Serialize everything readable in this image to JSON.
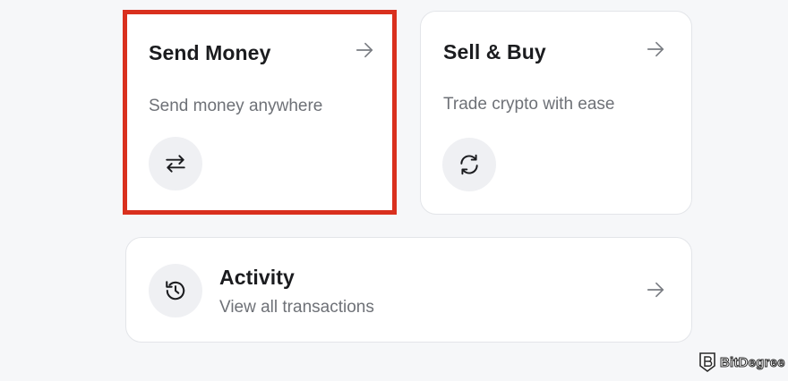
{
  "cards": {
    "send": {
      "title": "Send Money",
      "subtitle": "Send money anywhere",
      "icon": "swap-arrows-icon",
      "highlight_color": "#d9301e"
    },
    "sell": {
      "title": "Sell & Buy",
      "subtitle": "Trade crypto with ease",
      "icon": "refresh-icon"
    },
    "activity": {
      "title": "Activity",
      "subtitle": "View all transactions",
      "icon": "history-icon"
    }
  },
  "watermark": {
    "text": "BitDegree"
  },
  "colors": {
    "background": "#f6f7f9",
    "card": "#ffffff",
    "icon_circle": "#eff0f3",
    "text_primary": "#1b1c1f",
    "text_secondary": "#6e7177",
    "arrow": "#7a7d83"
  }
}
